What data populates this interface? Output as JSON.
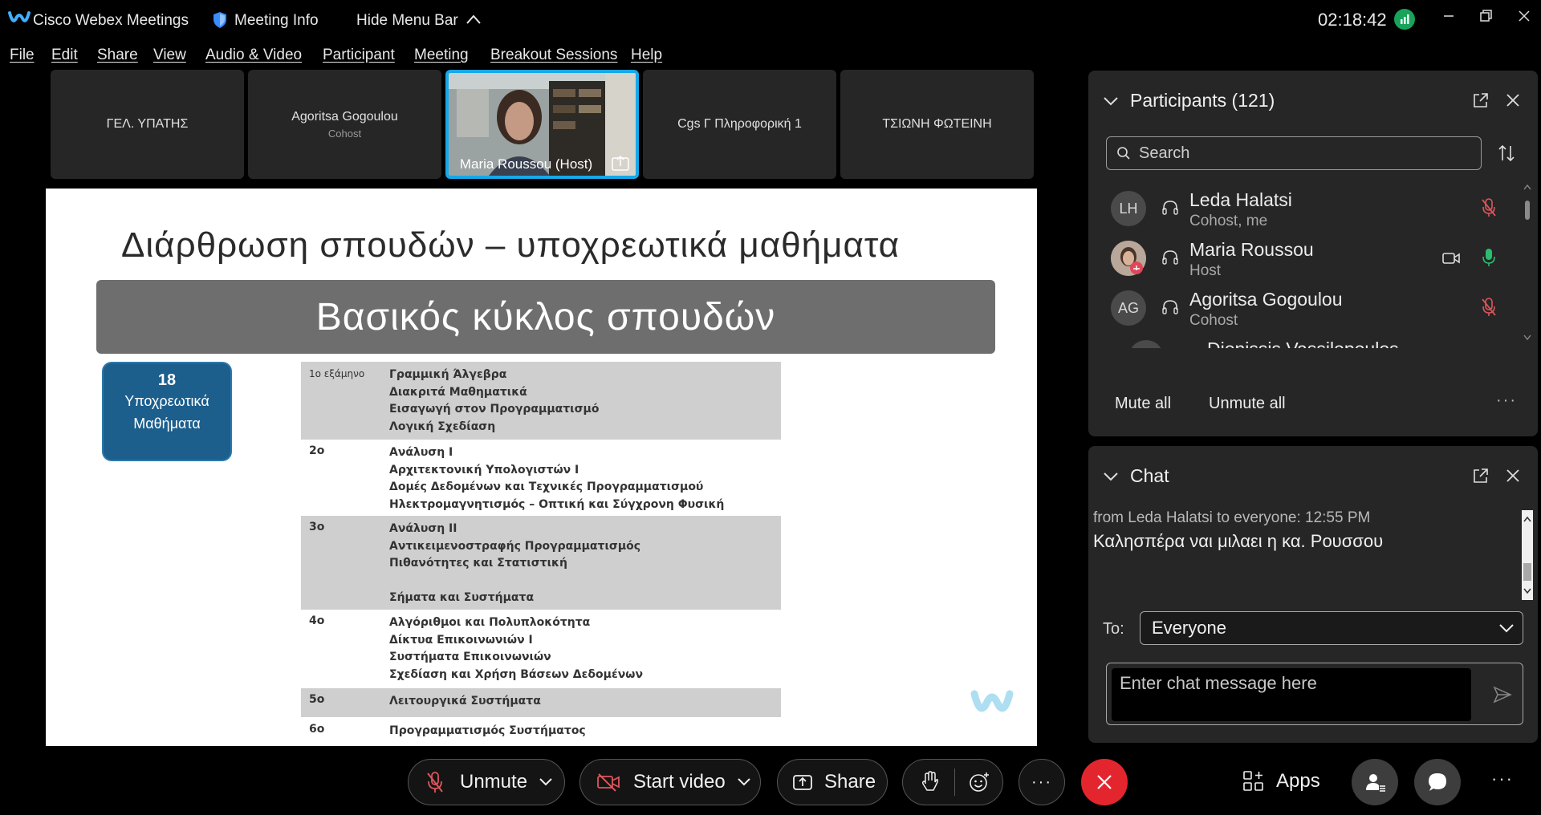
{
  "titlebar": {
    "app_name": "Cisco Webex Meetings",
    "meeting_info": "Meeting Info",
    "hide_menu_bar": "Hide Menu Bar",
    "clock": "02:18:42"
  },
  "menu": [
    "File",
    "Edit",
    "Share",
    "View",
    "Audio & Video",
    "Participant",
    "Meeting",
    "Breakout Sessions",
    "Help"
  ],
  "tiles": [
    {
      "name": "ΓΕΛ. ΥΠΑΤΗΣ",
      "sub": ""
    },
    {
      "name": "Agoritsa Gogoulou",
      "sub": "Cohost"
    },
    {
      "name": "Maria Roussou  (Host)",
      "sub": ""
    },
    {
      "name": "Cgs Γ Πληροφορική 1",
      "sub": ""
    },
    {
      "name": "ΤΣΙΩΝΗ ΦΩΤΕΙΝΗ",
      "sub": ""
    }
  ],
  "slide": {
    "title": "Διάρθρωση σπουδών – υποχρεωτικά μαθήματα",
    "banner": "Βασικός κύκλος σπουδών",
    "badge_num": "18",
    "badge_line1": "Υποχρεωτικά",
    "badge_line2": "Μαθήματα",
    "semesters": [
      {
        "label": "1ο εξάμηνο",
        "courses": "Γραμμική Άλγεβρα\nΔιακριτά Μαθηματικά\nΕισαγωγή στον Προγραμματισμό\nΛογική Σχεδίαση"
      },
      {
        "label": "2ο",
        "courses": "Ανάλυση Ι\nΑρχιτεκτονική Υπολογιστών Ι\nΔομές Δεδομένων και Τεχνικές Προγραμματισμού\nΗλεκτρομαγνητισμός – Οπτική και Σύγχρονη Φυσική"
      },
      {
        "label": "3ο",
        "courses": "Ανάλυση ΙΙ\nΑντικειμενοστραφής Προγραμματισμός\nΠιθανότητες και Στατιστική\n\nΣήματα και Συστήματα"
      },
      {
        "label": "4ο",
        "courses": "Αλγόριθμοι και Πολυπλοκότητα\nΔίκτυα Επικοινωνιών Ι\nΣυστήματα Επικοινωνιών\nΣχεδίαση και Χρήση Βάσεων Δεδομένων"
      },
      {
        "label": "5ο",
        "courses": "Λειτουργικά Συστήματα"
      },
      {
        "label": "6ο",
        "courses": "Προγραμματισμός Συστήματος"
      }
    ]
  },
  "participants": {
    "title": "Participants (121)",
    "search_placeholder": "Search",
    "list": [
      {
        "initials": "LH",
        "name": "Leda Halatsi",
        "role": "Cohost, me"
      },
      {
        "initials": "",
        "name": "Maria Roussou",
        "role": "Host"
      },
      {
        "initials": "AG",
        "name": "Agoritsa Gogoulou",
        "role": "Cohost"
      },
      {
        "initials": "",
        "name": "Dionissis Vassilopoulos",
        "role": ""
      }
    ],
    "mute_all": "Mute all",
    "unmute_all": "Unmute all",
    "more": "···"
  },
  "chat": {
    "title": "Chat",
    "meta": "from Leda Halatsi to everyone:    12:55 PM",
    "message": "Καλησπέρα ναι μιλαει η κα. Ρουσσου",
    "to_label": "To:",
    "to_value": "Everyone",
    "input_placeholder": "Enter chat message here"
  },
  "toolbar": {
    "unmute": "Unmute",
    "start_video": "Start video",
    "share": "Share",
    "more": "···",
    "apps": "Apps",
    "more_right": "···"
  },
  "colors": {
    "accent": "#16a8e8",
    "leave": "#e3262e",
    "muted": "#e0555c",
    "unmuted": "#2bbd6e"
  }
}
